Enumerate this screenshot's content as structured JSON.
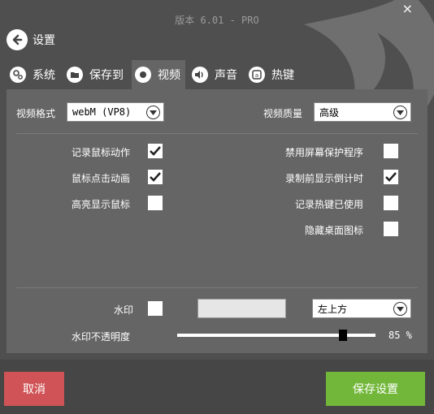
{
  "window": {
    "title": "版本 6.01 - PRO",
    "close_glyph": "×"
  },
  "back": {
    "label": "设置"
  },
  "tabs": [
    {
      "label": "系统",
      "icon": "gears-icon",
      "active": false
    },
    {
      "label": "保存到",
      "icon": "folder-icon",
      "active": false
    },
    {
      "label": "视频",
      "icon": "record-icon",
      "active": true
    },
    {
      "label": "声音",
      "icon": "speaker-icon",
      "active": false
    },
    {
      "label": "热键",
      "icon": "hotkey-icon",
      "active": false
    }
  ],
  "video": {
    "format_label": "视频格式",
    "format_value": "webM (VP8)",
    "quality_label": "视频质量",
    "quality_value": "高级"
  },
  "options_left": [
    {
      "label": "记录鼠标动作",
      "checked": true
    },
    {
      "label": "鼠标点击动画",
      "checked": true
    },
    {
      "label": "高亮显示鼠标",
      "checked": false
    }
  ],
  "options_right": [
    {
      "label": "禁用屏幕保护程序",
      "checked": false
    },
    {
      "label": "录制前显示倒计时",
      "checked": true
    },
    {
      "label": "记录热键已使用",
      "checked": false
    },
    {
      "label": "隐藏桌面图标",
      "checked": false
    }
  ],
  "watermark": {
    "label": "水印",
    "checked": false,
    "text_value": "",
    "position_value": "左上方",
    "opacity_label": "水印不透明度",
    "opacity_value": 85,
    "opacity_text": "85 %"
  },
  "buttons": {
    "cancel": "取消",
    "save": "保存设置"
  },
  "colors": {
    "cancel": "#d05457",
    "save": "#72b73a",
    "panel": "#656565",
    "background": "#4f4f4f"
  }
}
